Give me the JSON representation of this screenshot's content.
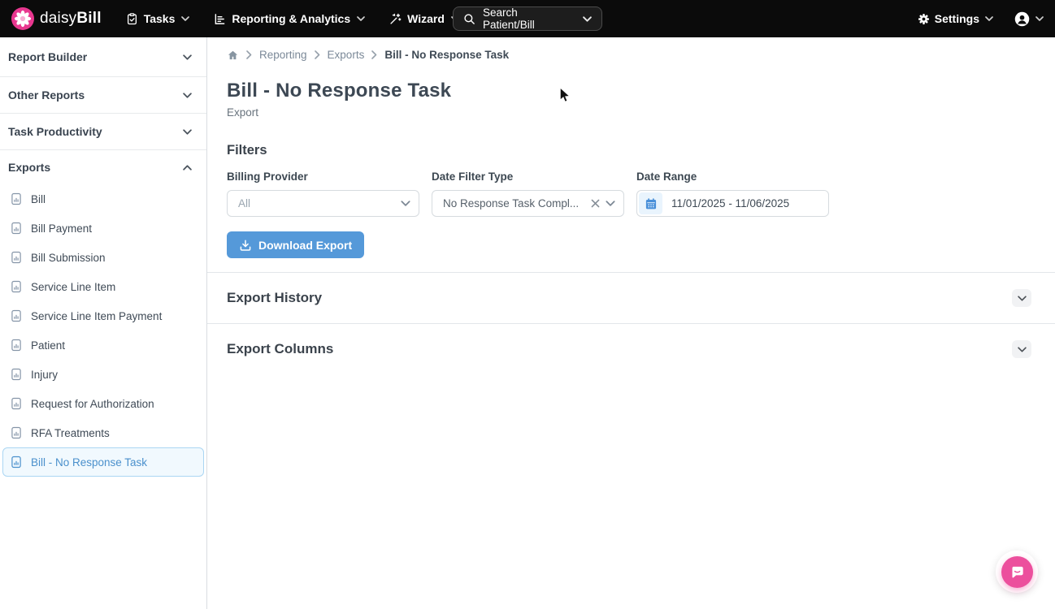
{
  "navbar": {
    "brand": {
      "name_regular": "daisy",
      "name_bold": "Bill"
    },
    "menus": [
      {
        "label": "Tasks"
      },
      {
        "label": "Reporting & Analytics"
      },
      {
        "label": "Wizard"
      }
    ],
    "search": {
      "label": "Search Patient/Bill"
    },
    "settings": {
      "label": "Settings"
    }
  },
  "sidebar": {
    "sections": [
      {
        "label": "Report Builder"
      },
      {
        "label": "Other Reports"
      },
      {
        "label": "Task Productivity"
      },
      {
        "label": "Exports"
      }
    ],
    "export_items": [
      {
        "label": "Bill"
      },
      {
        "label": "Bill Payment"
      },
      {
        "label": "Bill Submission"
      },
      {
        "label": "Service Line Item"
      },
      {
        "label": "Service Line Item Payment"
      },
      {
        "label": "Patient"
      },
      {
        "label": "Injury"
      },
      {
        "label": "Request for Authorization"
      },
      {
        "label": "RFA Treatments"
      },
      {
        "label": "Bill - No Response Task",
        "selected": true
      }
    ]
  },
  "breadcrumb": {
    "links": [
      "Reporting",
      "Exports"
    ],
    "current": "Bill - No Response Task"
  },
  "page": {
    "title": "Bill - No Response Task",
    "subtitle": "Export"
  },
  "filters": {
    "heading": "Filters",
    "billing_provider": {
      "label": "Billing Provider",
      "value": "All"
    },
    "date_filter_type": {
      "label": "Date Filter Type",
      "value": "No Response Task Compl..."
    },
    "date_range": {
      "label": "Date Range",
      "value": "11/01/2025 - 11/06/2025"
    },
    "download_button_label": "Download Export"
  },
  "panels": [
    {
      "title": "Export History"
    },
    {
      "title": "Export Columns"
    }
  ],
  "colors": {
    "navbar_bg": "#0b0b0b",
    "accent_blue": "#5599d9",
    "brand_pink": "#e8378f",
    "selected_item_blue": "#4a90cc",
    "selected_item_bg": "#f1f9fe",
    "chat_pink": "#ec4f9d",
    "calendar_icon_blue": "#4a90d9"
  }
}
